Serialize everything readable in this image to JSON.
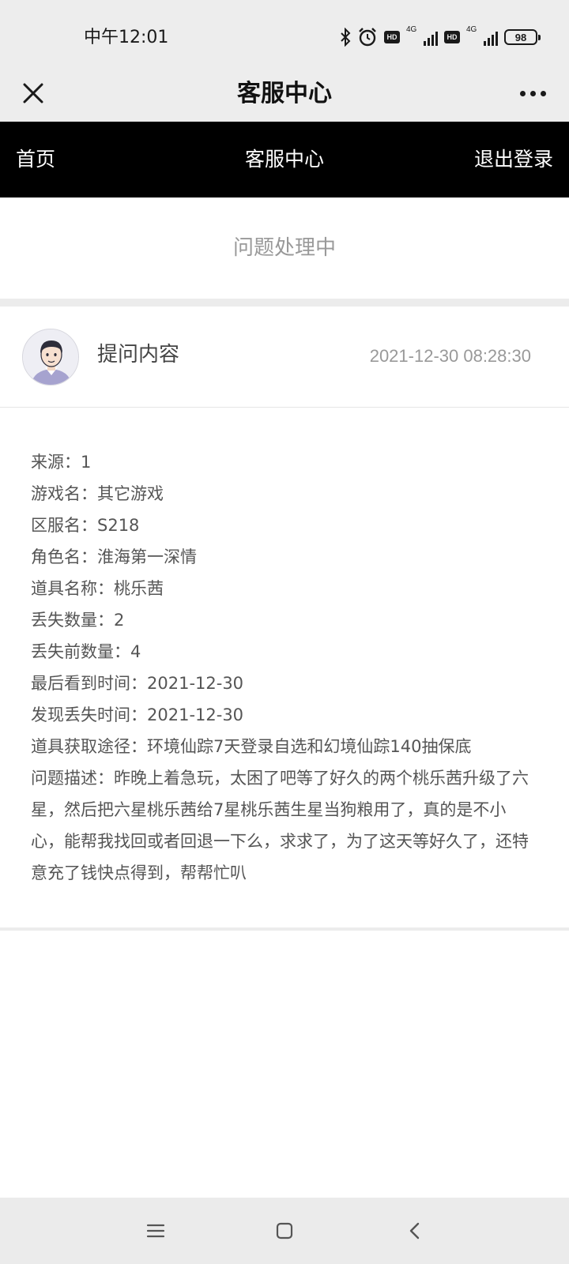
{
  "status_bar": {
    "time": "中午12:01",
    "battery": "98",
    "network_1": "4G",
    "network_2": "4G",
    "hd_1": "HD",
    "hd_2": "HD"
  },
  "title_bar": {
    "title": "客服中心"
  },
  "nav": {
    "home": "首页",
    "center": "客服中心",
    "logout": "退出登录"
  },
  "status": {
    "text": "问题处理中"
  },
  "question": {
    "label": "提问内容",
    "time": "2021-12-30 08:28:30",
    "details": [
      "来源：1",
      "游戏名：其它游戏",
      "区服名：S218",
      "角色名：淮海第一深情",
      "道具名称：桃乐茜",
      "丢失数量：2",
      "丢失前数量：4",
      "最后看到时间：2021-12-30",
      "发现丢失时间：2021-12-30",
      "道具获取途径：环境仙踪7天登录自选和幻境仙踪140抽保底"
    ],
    "description": "问题描述：昨晚上着急玩，太困了吧等了好久的两个桃乐茜升级了六星，然后把六星桃乐茜给7星桃乐茜生星当狗粮用了，真的是不小心，能帮我找回或者回退一下么，求求了，为了这天等好久了，还特意充了钱快点得到，帮帮忙叭"
  },
  "icons": {
    "close": "close-icon",
    "more": "more-icon",
    "bluetooth": "bluetooth-icon",
    "alarm": "alarm-icon",
    "menu": "menu-icon",
    "home": "home-icon",
    "back": "back-icon"
  }
}
